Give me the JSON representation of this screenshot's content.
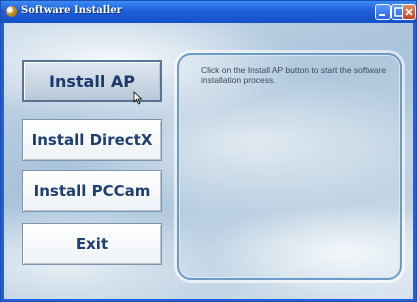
{
  "window": {
    "title": "Software Installer"
  },
  "buttons": {
    "install_ap": "Install AP",
    "install_directx": "Install DirectX",
    "install_pccam": "Install PCCam",
    "exit": "Exit"
  },
  "info": {
    "text": "Click on the Install AP button to start the software installation process."
  },
  "colors": {
    "titlebar": "#1f5fd8",
    "button_text": "#1f3f73",
    "panel_border": "#6f9cc7"
  }
}
